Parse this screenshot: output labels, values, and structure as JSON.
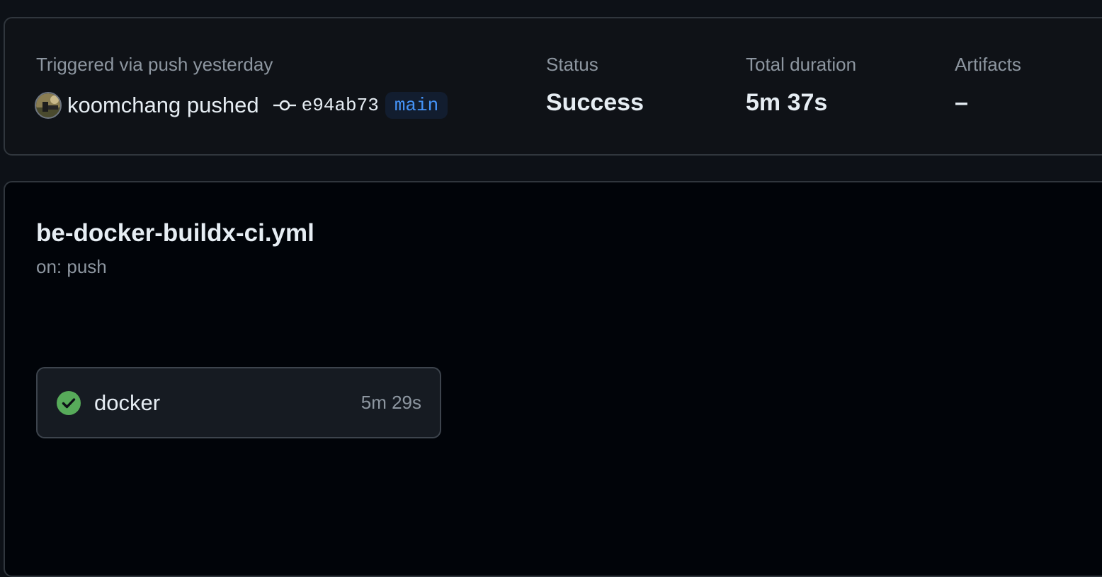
{
  "summary": {
    "trigger_label": "Triggered via push yesterday",
    "actor_text": "koomchang pushed",
    "commit_sha": "e94ab73",
    "branch": "main",
    "status_label": "Status",
    "status_value": "Success",
    "duration_label": "Total duration",
    "duration_value": "5m 37s",
    "artifacts_label": "Artifacts",
    "artifacts_value": "–"
  },
  "workflow": {
    "file_name": "be-docker-buildx-ci.yml",
    "trigger_text": "on: push",
    "jobs": [
      {
        "name": "docker",
        "duration": "5m 29s",
        "status": "success",
        "status_icon": "check-circle-icon"
      }
    ]
  },
  "colors": {
    "success": "#57ab5a",
    "branch_text": "#4493f8",
    "muted_text": "#8d96a0"
  }
}
